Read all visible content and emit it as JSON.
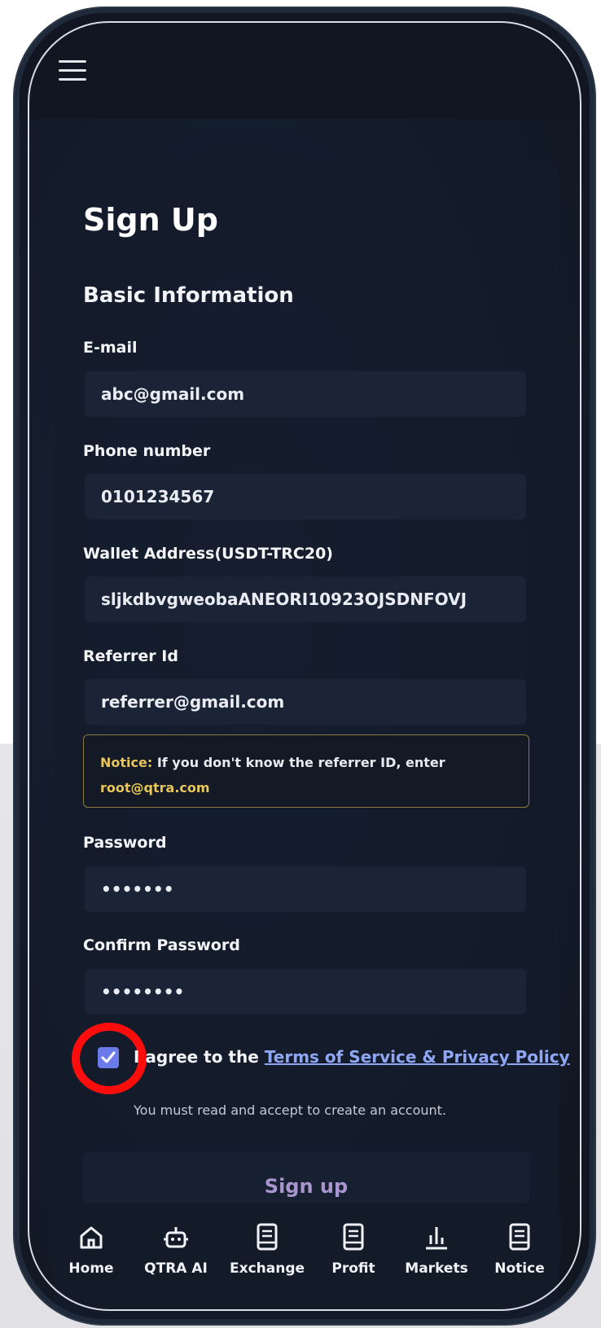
{
  "page": {
    "title": "Sign Up",
    "section": "Basic Information"
  },
  "form": {
    "email": {
      "label": "E-mail",
      "value": "abc@gmail.com"
    },
    "phone": {
      "label": "Phone number",
      "value": "0101234567"
    },
    "wallet": {
      "label": "Wallet Address(USDT-TRC20)",
      "value": "sljkdbvgweobaANEORI10923OJSDNFOVJ"
    },
    "referrer": {
      "label": "Referrer Id",
      "value": "referrer@gmail.com"
    },
    "notice": {
      "label": "Notice:",
      "text": " If you don't know the referrer ID, enter",
      "email": "root@qtra.com"
    },
    "password": {
      "label": "Password",
      "value": "•••••••"
    },
    "confirm_password": {
      "label": "Confirm Password",
      "value": "••••••••"
    },
    "agree": {
      "checked": true,
      "prefix": "I agree to the",
      "link": "Terms of Service & Privacy Policy",
      "hint": "You must read and accept to create an account."
    },
    "submit_label": "Sign up"
  },
  "nav": {
    "items": [
      {
        "label": "Home",
        "icon": "home-icon"
      },
      {
        "label": "QTRA AI",
        "icon": "robot-icon"
      },
      {
        "label": "Exchange",
        "icon": "document-icon"
      },
      {
        "label": "Profit",
        "icon": "document-icon"
      },
      {
        "label": "Markets",
        "icon": "bar-chart-icon"
      },
      {
        "label": "Notice",
        "icon": "document-icon"
      }
    ]
  },
  "colors": {
    "accent": "#6b7bea",
    "link": "#8fa6f3",
    "notice": "#e7c55a",
    "highlight": "#ff0d0d"
  }
}
